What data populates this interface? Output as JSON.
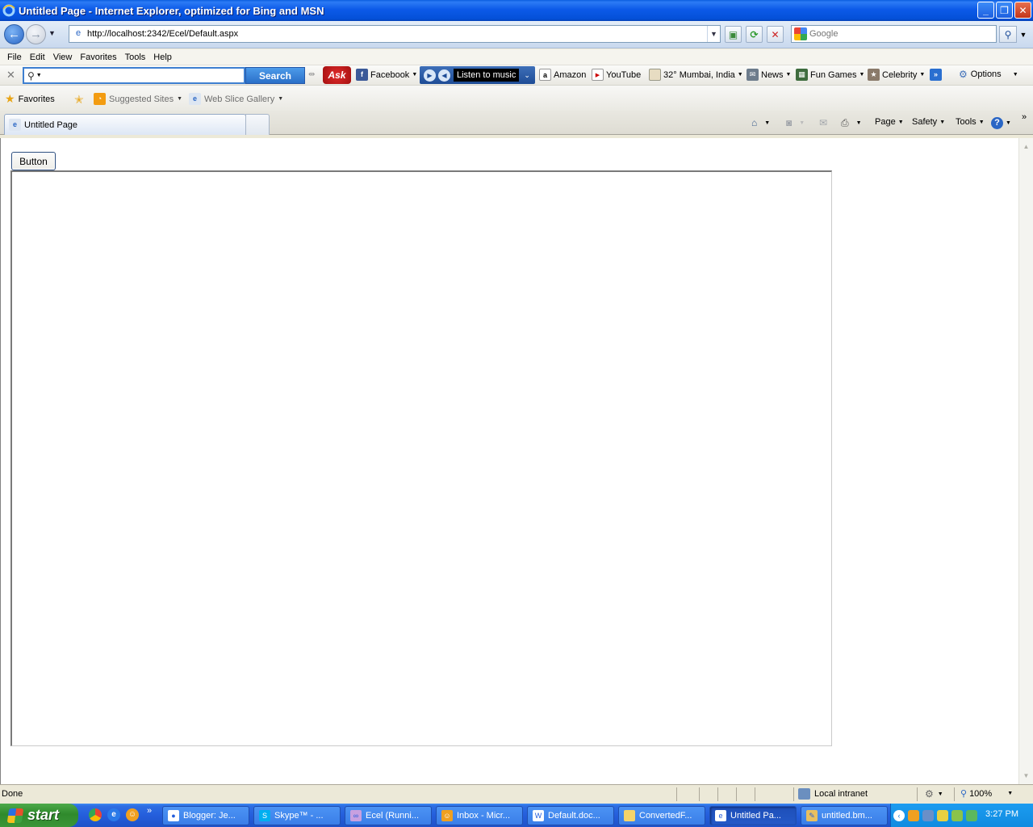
{
  "window": {
    "title": "Untitled Page - Internet Explorer, optimized for Bing and MSN"
  },
  "address_bar": {
    "url": "http://localhost:2342/Ecel/Default.aspx",
    "search_placeholder": "Google"
  },
  "menu": {
    "items": [
      "File",
      "Edit",
      "View",
      "Favorites",
      "Tools",
      "Help"
    ]
  },
  "ask_toolbar": {
    "search_button": "Search",
    "facebook": "Facebook",
    "music": "Listen to music",
    "amazon": "Amazon",
    "youtube": "YouTube",
    "weather": "32° Mumbai, India",
    "news": "News",
    "fun_games": "Fun Games",
    "celebrity": "Celebrity",
    "options": "Options"
  },
  "favorites_bar": {
    "favorites": "Favorites",
    "suggested_sites": "Suggested Sites",
    "web_slice_gallery": "Web Slice Gallery"
  },
  "tabs": {
    "active_tab": "Untitled Page"
  },
  "command_bar": {
    "page": "Page",
    "safety": "Safety",
    "tools": "Tools"
  },
  "content": {
    "button_label": "Button"
  },
  "status_bar": {
    "status": "Done",
    "zone": "Local intranet",
    "zoom": "100%"
  },
  "taskbar": {
    "start": "start",
    "tasks": [
      "Blogger: Je...",
      "Skype™ - ...",
      "Ecel (Runni...",
      "Inbox - Micr...",
      "Default.doc...",
      "ConvertedF...",
      "Untitled Pa...",
      "untitled.bm..."
    ],
    "clock": "3:27 PM"
  },
  "colors": {
    "title_bar": "#0A5FE0",
    "taskbar": "#245EDC",
    "start_button": "#3B9538",
    "ask_search_button": "#2A6FC8"
  }
}
